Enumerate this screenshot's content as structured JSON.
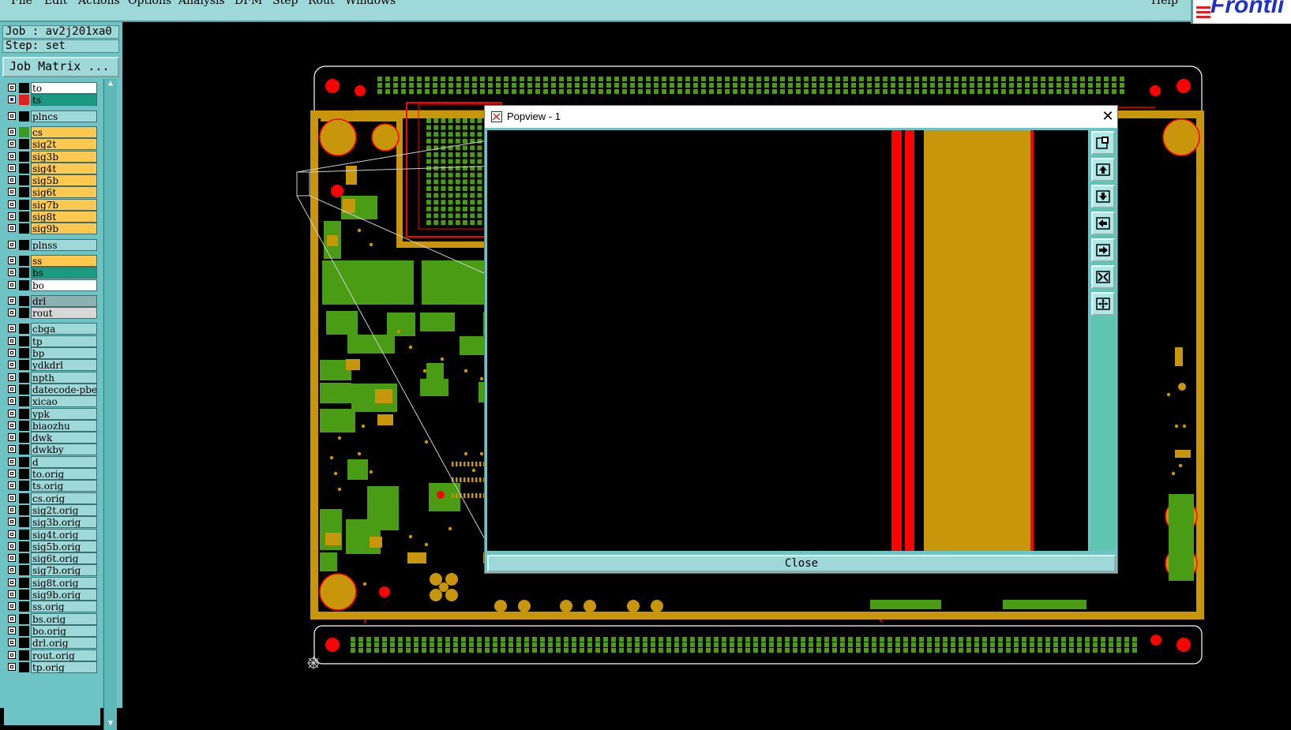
{
  "menu": {
    "items": [
      "File",
      "Edit",
      "Actions",
      "Options",
      "Analysis",
      "DFM",
      "Step",
      "Rout",
      "Windows"
    ],
    "help": "Help"
  },
  "logo": {
    "text": "Frontli"
  },
  "job": {
    "label": "Job : av2j201xa0",
    "step": "Step: set",
    "matrix_button": "Job Matrix ..."
  },
  "layers": [
    {
      "name": "to",
      "color": "#ffffff",
      "swatch": "#000000",
      "on": false
    },
    {
      "name": "ts",
      "color": "#1a9a80",
      "swatch": "#e02020",
      "on": true
    },
    {
      "name": "plncs",
      "color": "#9fd8d8",
      "swatch": "#000000",
      "on": false
    },
    {
      "name": "cs",
      "color": "#ffc850",
      "swatch": "#3a9a20",
      "on": false
    },
    {
      "name": "sig2t",
      "color": "#ffc850",
      "swatch": "#000000",
      "on": false
    },
    {
      "name": "sig3b",
      "color": "#ffc850",
      "swatch": "#000000",
      "on": false
    },
    {
      "name": "sig4t",
      "color": "#ffc850",
      "swatch": "#000000",
      "on": false
    },
    {
      "name": "sig5b",
      "color": "#ffc850",
      "swatch": "#000000",
      "on": false
    },
    {
      "name": "sig6t",
      "color": "#ffc850",
      "swatch": "#000000",
      "on": false
    },
    {
      "name": "sig7b",
      "color": "#ffc850",
      "swatch": "#000000",
      "on": false
    },
    {
      "name": "sig8t",
      "color": "#ffc850",
      "swatch": "#000000",
      "on": false
    },
    {
      "name": "sig9b",
      "color": "#ffc850",
      "swatch": "#000000",
      "on": false
    },
    {
      "name": "plnss",
      "color": "#9fd8d8",
      "swatch": "#000000",
      "on": false
    },
    {
      "name": "ss",
      "color": "#ffc850",
      "swatch": "#000000",
      "on": false
    },
    {
      "name": "bs",
      "color": "#1a9a80",
      "swatch": "#000000",
      "on": false
    },
    {
      "name": "bo",
      "color": "#ffffff",
      "swatch": "#000000",
      "on": false
    },
    {
      "name": "drl",
      "color": "#8fb0b0",
      "swatch": "#000000",
      "on": false
    },
    {
      "name": "rout",
      "color": "#d8d8d8",
      "swatch": "#000000",
      "on": false
    },
    {
      "name": "cbga",
      "color": "#9fd8d8",
      "swatch": "#000000",
      "on": false
    },
    {
      "name": "tp",
      "color": "#9fd8d8",
      "swatch": "#000000",
      "on": false
    },
    {
      "name": "bp",
      "color": "#9fd8d8",
      "swatch": "#000000",
      "on": false
    },
    {
      "name": "ydkdrl",
      "color": "#9fd8d8",
      "swatch": "#000000",
      "on": false
    },
    {
      "name": "npth",
      "color": "#9fd8d8",
      "swatch": "#000000",
      "on": false
    },
    {
      "name": "datecode-pbe",
      "color": "#9fd8d8",
      "swatch": "#000000",
      "on": false
    },
    {
      "name": "xicao",
      "color": "#9fd8d8",
      "swatch": "#000000",
      "on": false
    },
    {
      "name": "ypk",
      "color": "#9fd8d8",
      "swatch": "#000000",
      "on": false
    },
    {
      "name": "biaozhu",
      "color": "#9fd8d8",
      "swatch": "#000000",
      "on": false
    },
    {
      "name": "dwk",
      "color": "#9fd8d8",
      "swatch": "#000000",
      "on": false
    },
    {
      "name": "dwkby",
      "color": "#9fd8d8",
      "swatch": "#000000",
      "on": false
    },
    {
      "name": "d",
      "color": "#9fd8d8",
      "swatch": "#000000",
      "on": false
    },
    {
      "name": "to.orig",
      "color": "#9fd8d8",
      "swatch": "#000000",
      "on": false
    },
    {
      "name": "ts.orig",
      "color": "#9fd8d8",
      "swatch": "#000000",
      "on": false
    },
    {
      "name": "cs.orig",
      "color": "#9fd8d8",
      "swatch": "#000000",
      "on": false
    },
    {
      "name": "sig2t.orig",
      "color": "#9fd8d8",
      "swatch": "#000000",
      "on": false
    },
    {
      "name": "sig3b.orig",
      "color": "#9fd8d8",
      "swatch": "#000000",
      "on": false
    },
    {
      "name": "sig4t.orig",
      "color": "#9fd8d8",
      "swatch": "#000000",
      "on": false
    },
    {
      "name": "sig5b.orig",
      "color": "#9fd8d8",
      "swatch": "#000000",
      "on": false
    },
    {
      "name": "sig6t.orig",
      "color": "#9fd8d8",
      "swatch": "#000000",
      "on": false
    },
    {
      "name": "sig7b.orig",
      "color": "#9fd8d8",
      "swatch": "#000000",
      "on": false
    },
    {
      "name": "sig8t.orig",
      "color": "#9fd8d8",
      "swatch": "#000000",
      "on": false
    },
    {
      "name": "sig9b.orig",
      "color": "#9fd8d8",
      "swatch": "#000000",
      "on": false
    },
    {
      "name": "ss.orig",
      "color": "#9fd8d8",
      "swatch": "#000000",
      "on": false
    },
    {
      "name": "bs.orig",
      "color": "#9fd8d8",
      "swatch": "#000000",
      "on": false
    },
    {
      "name": "bo.orig",
      "color": "#9fd8d8",
      "swatch": "#000000",
      "on": false
    },
    {
      "name": "drl.orig",
      "color": "#9fd8d8",
      "swatch": "#000000",
      "on": false
    },
    {
      "name": "rout.orig",
      "color": "#9fd8d8",
      "swatch": "#000000",
      "on": false
    },
    {
      "name": "tp.orig",
      "color": "#9fd8d8",
      "swatch": "#000000",
      "on": false
    }
  ],
  "popview": {
    "title": "Popview - 1",
    "close_button": "Close",
    "tools": [
      "zoom-window-icon",
      "pan-up-icon",
      "pan-down-icon",
      "pan-left-icon",
      "pan-right-icon",
      "zoom-fit-icon",
      "zoom-center-icon"
    ]
  },
  "colors": {
    "copper": "#c8960a",
    "pad_green": "#4a9c14",
    "via_red": "#ff0000",
    "outline": "#e02020",
    "panel": "#6ec4c4",
    "menubar": "#9fd8d8"
  }
}
